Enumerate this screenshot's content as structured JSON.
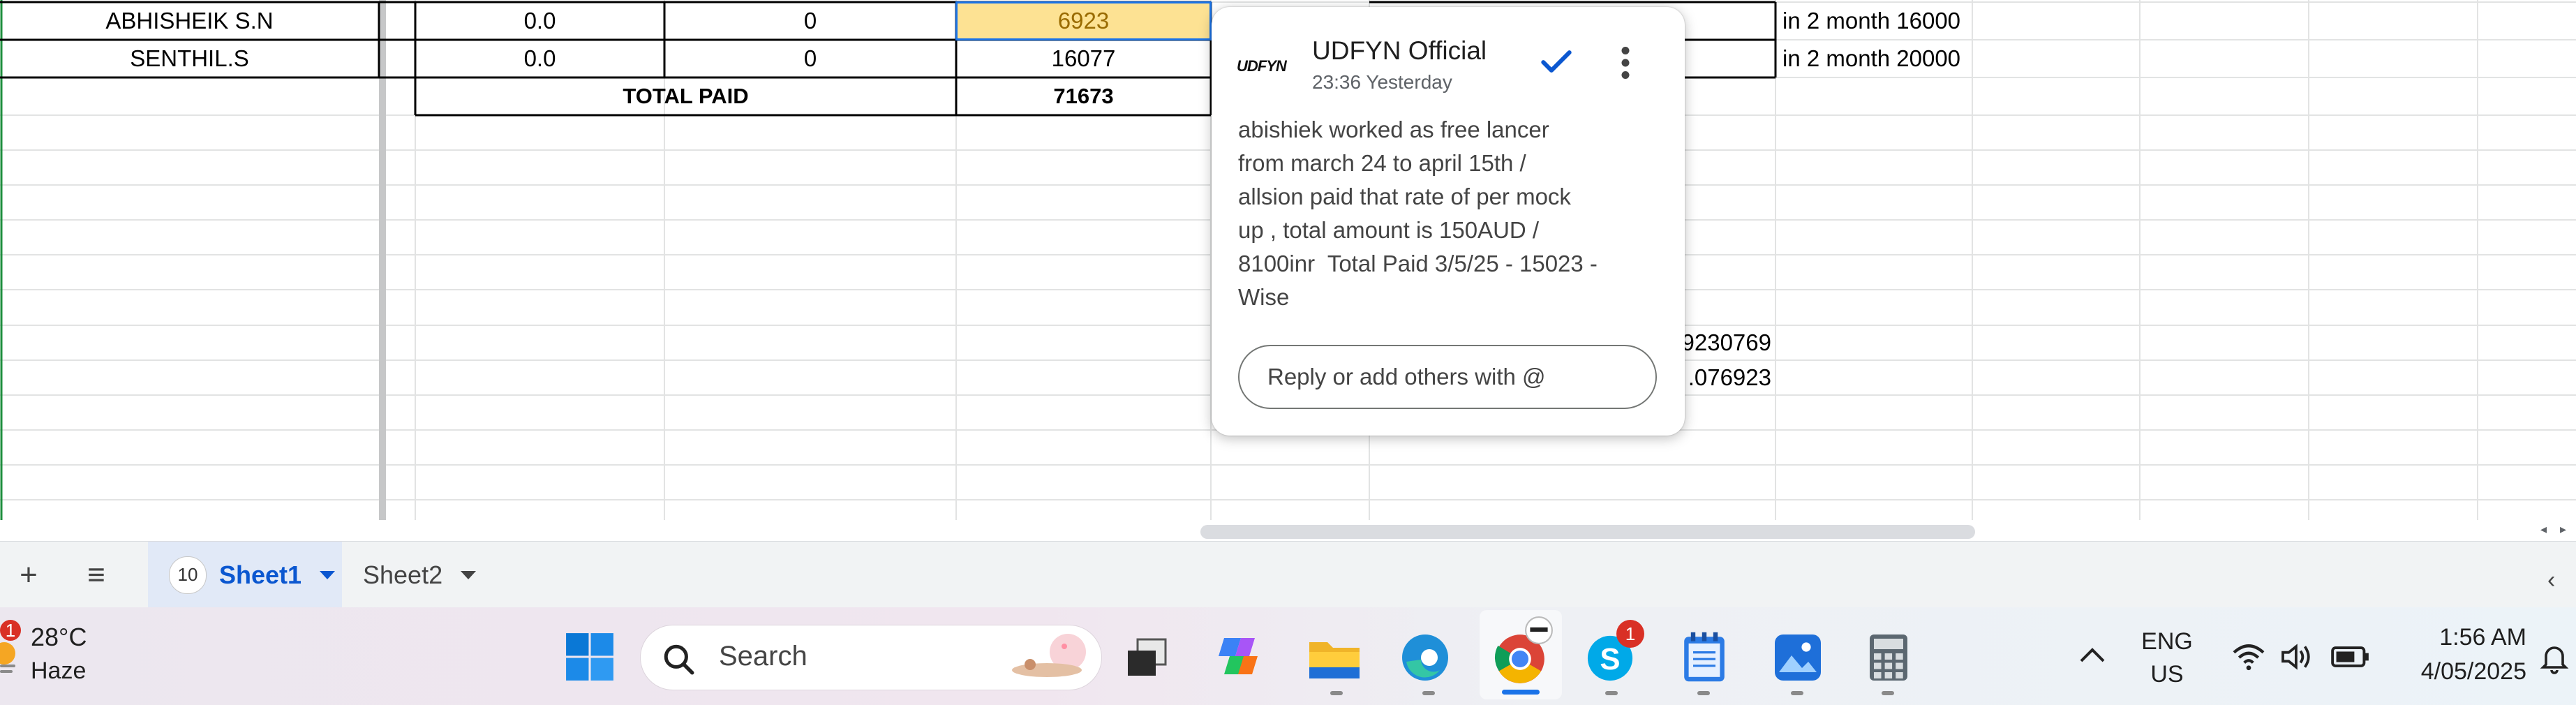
{
  "spreadsheet": {
    "rows": [
      {
        "name": "ABHISHEIK S.N",
        "col2": "0.0",
        "col3": "0",
        "col4": "6923",
        "note": "in 2 month 16000"
      },
      {
        "name": "SENTHIL.S",
        "col2": "0.0",
        "col3": "0",
        "col4": "16077",
        "note": "in 2 month 20000"
      }
    ],
    "total_label": "TOTAL PAID",
    "total_value": "71673",
    "partial_values": [
      "9230769",
      ".076923"
    ]
  },
  "comment": {
    "author": "UDFYN Official",
    "logo_text": "UDFYN",
    "time": "23:36 Yesterday",
    "body": "abishiek worked as free lancer\nfrom march 24 to april 15th /\nallsion paid that rate of per mock\nup , total amount is 150AUD /\n8100inr  Total Paid 3/5/25 - 15023 -\nWise",
    "reply_placeholder": "Reply or add others with @"
  },
  "sheet_tabs": {
    "add_label": "+",
    "menu_label": "≡",
    "tabs": [
      {
        "label": "Sheet1",
        "badge": "10",
        "active": true
      },
      {
        "label": "Sheet2",
        "active": false
      }
    ]
  },
  "taskbar": {
    "weather": {
      "temp": "28°C",
      "condition": "Haze",
      "badge": "1"
    },
    "search_label": "Search",
    "apps": [
      "windows-start",
      "copilot",
      "task-view",
      "file-explorer",
      "edge",
      "chrome",
      "skype",
      "notepad",
      "photos",
      "calculator"
    ],
    "skype_badge": "1",
    "language": {
      "line1": "ENG",
      "line2": "US"
    },
    "clock": {
      "time": "1:56 AM",
      "date": "4/05/2025"
    }
  }
}
